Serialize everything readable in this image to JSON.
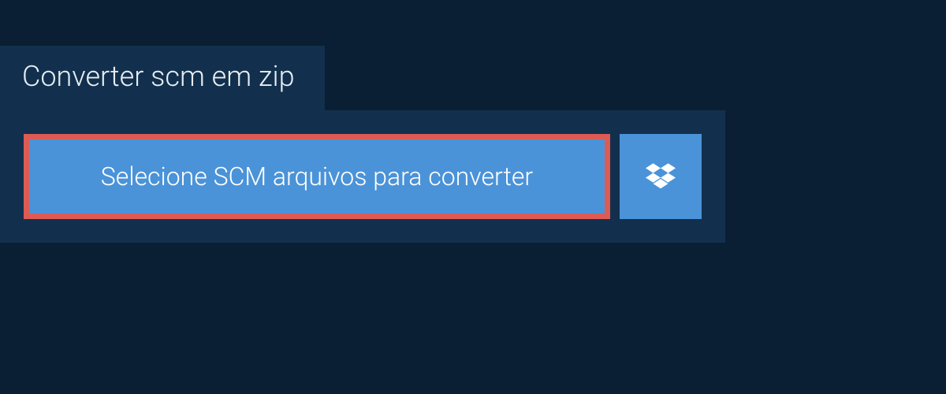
{
  "tab": {
    "label": "Converter scm em zip"
  },
  "actions": {
    "select_label": "Selecione SCM arquivos para converter",
    "dropbox_icon": "dropbox-icon"
  },
  "colors": {
    "background": "#0a1f33",
    "panel": "#12304d",
    "button": "#4b93d8",
    "highlight_border": "#dd5b54",
    "text": "#ffffff"
  }
}
